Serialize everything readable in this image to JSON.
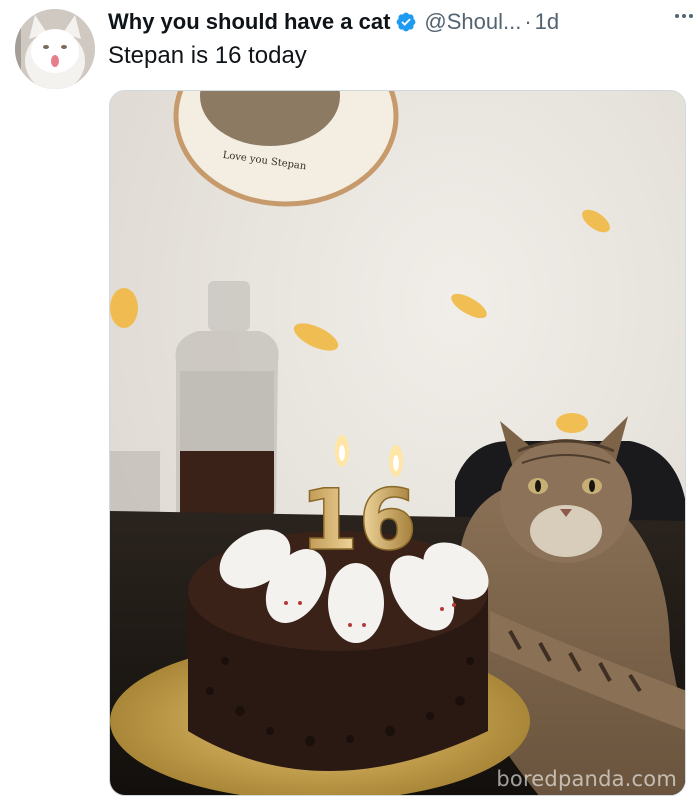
{
  "tweet": {
    "display_name": "Why you should have a cat",
    "handle": "@Shoul...",
    "separator": "·",
    "timestamp": "1d",
    "text": "Stepan is 16 today",
    "icons": {
      "avatar": "cat-avatar",
      "verified": "verified-badge-icon",
      "more": "more-options-icon"
    },
    "colors": {
      "verified": "#1d9bf0",
      "secondary_text": "#536471"
    }
  },
  "media": {
    "embroidery_text": "Love you Stepan",
    "candle_number": "16",
    "watermark": "boredpanda.com"
  }
}
